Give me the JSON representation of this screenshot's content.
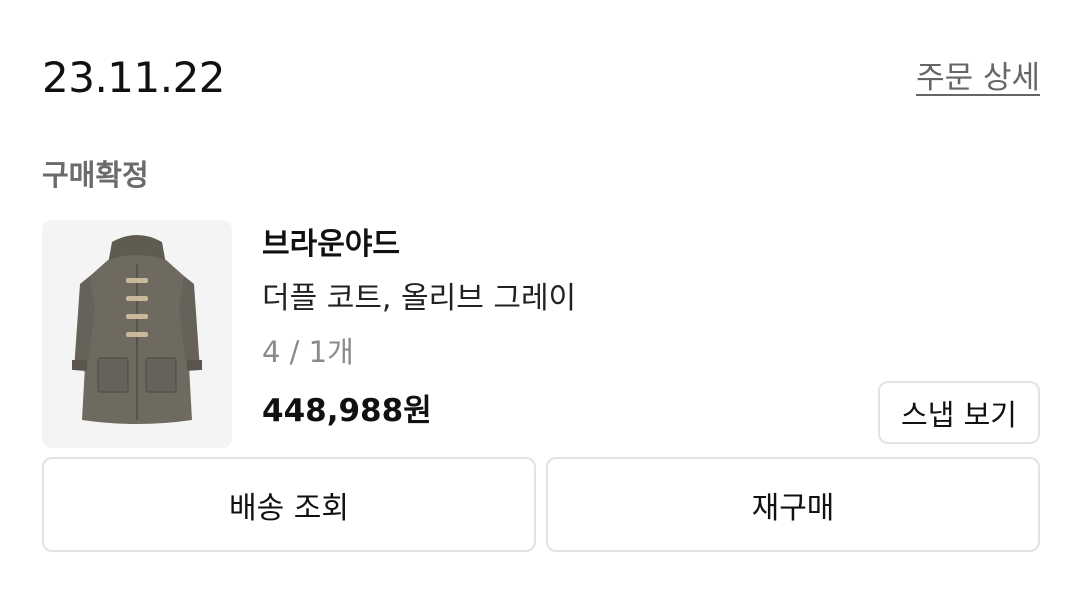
{
  "order": {
    "date": "23.11.22",
    "detail_link": "주문 상세",
    "status": "구매확정"
  },
  "product": {
    "brand": "브라운야드",
    "name": "더플 코트, 올리브 그레이",
    "option": "4 / 1개",
    "price": "448,988원",
    "image_icon": "duffle-coat-image",
    "coat_color": "#6f6a5f"
  },
  "actions": {
    "snap_label": "스냅 보기",
    "delivery_label": "배송 조회",
    "rebuy_label": "재구매"
  }
}
